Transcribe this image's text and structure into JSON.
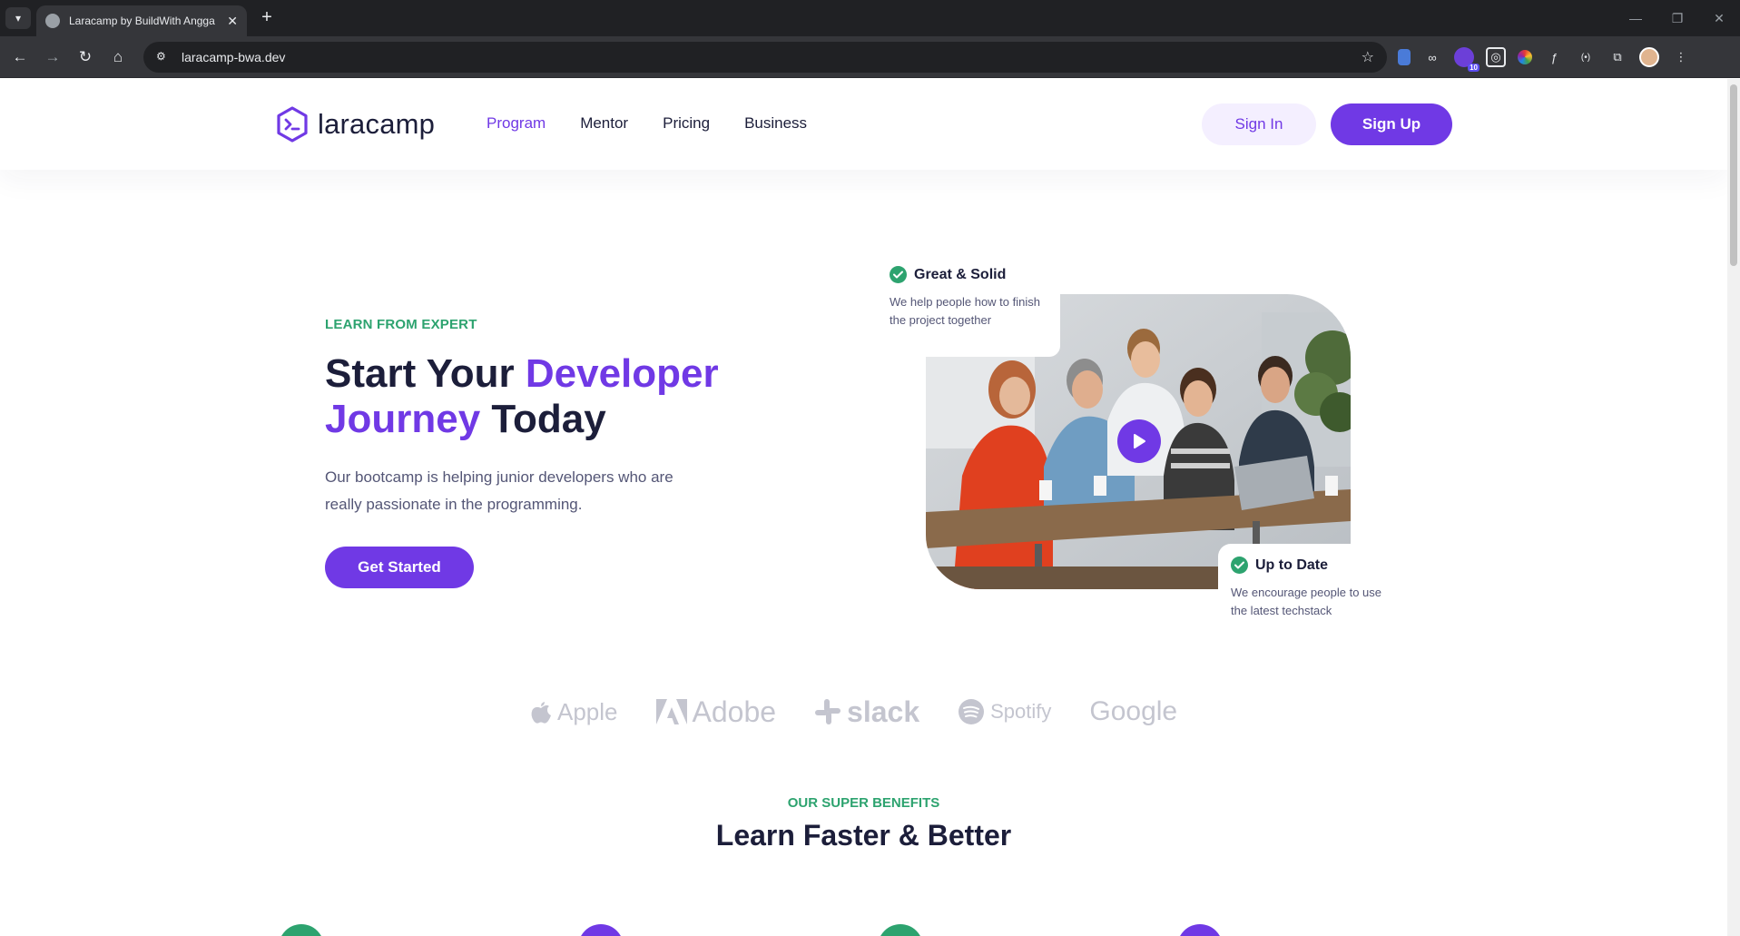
{
  "browser": {
    "tab_title": "Laracamp by BuildWith Angga",
    "url": "laracamp-bwa.dev",
    "extension_badge": "10",
    "icons": [
      "chevron-down-icon",
      "globe-icon",
      "close-icon",
      "plus-icon",
      "back-icon",
      "forward-icon",
      "reload-icon",
      "home-icon",
      "site-settings-icon",
      "star-icon",
      "puzzle-icon",
      "profile-icon",
      "more-icon"
    ]
  },
  "header": {
    "logo_text": "laracamp",
    "nav": [
      {
        "label": "Program",
        "active": true
      },
      {
        "label": "Mentor",
        "active": false
      },
      {
        "label": "Pricing",
        "active": false
      },
      {
        "label": "Business",
        "active": false
      }
    ],
    "sign_in": "Sign In",
    "sign_up": "Sign Up"
  },
  "hero": {
    "eyebrow": "LEARN FROM EXPERT",
    "title_part1": "Start Your ",
    "title_accent1": "Developer Journey",
    "title_part2": " Today",
    "subtitle": "Our bootcamp is helping junior developers who are really passionate in the programming.",
    "cta": "Get Started",
    "card_top": {
      "title": "Great & Solid",
      "text": "We help people how to finish the project together"
    },
    "card_bottom": {
      "title": "Up to Date",
      "text": "We encourage people to use the latest techstack"
    }
  },
  "partners": [
    "Apple",
    "Adobe",
    "slack",
    "Spotify",
    "Google"
  ],
  "benefits": {
    "eyebrow": "OUR SUPER BENEFITS",
    "title": "Learn Faster & Better"
  },
  "colors": {
    "primary": "#7039e5",
    "accent_green": "#2da36f",
    "text_dark": "#1c1e3a",
    "text_muted": "#545676",
    "logo_gray": "#c4c5cf"
  }
}
